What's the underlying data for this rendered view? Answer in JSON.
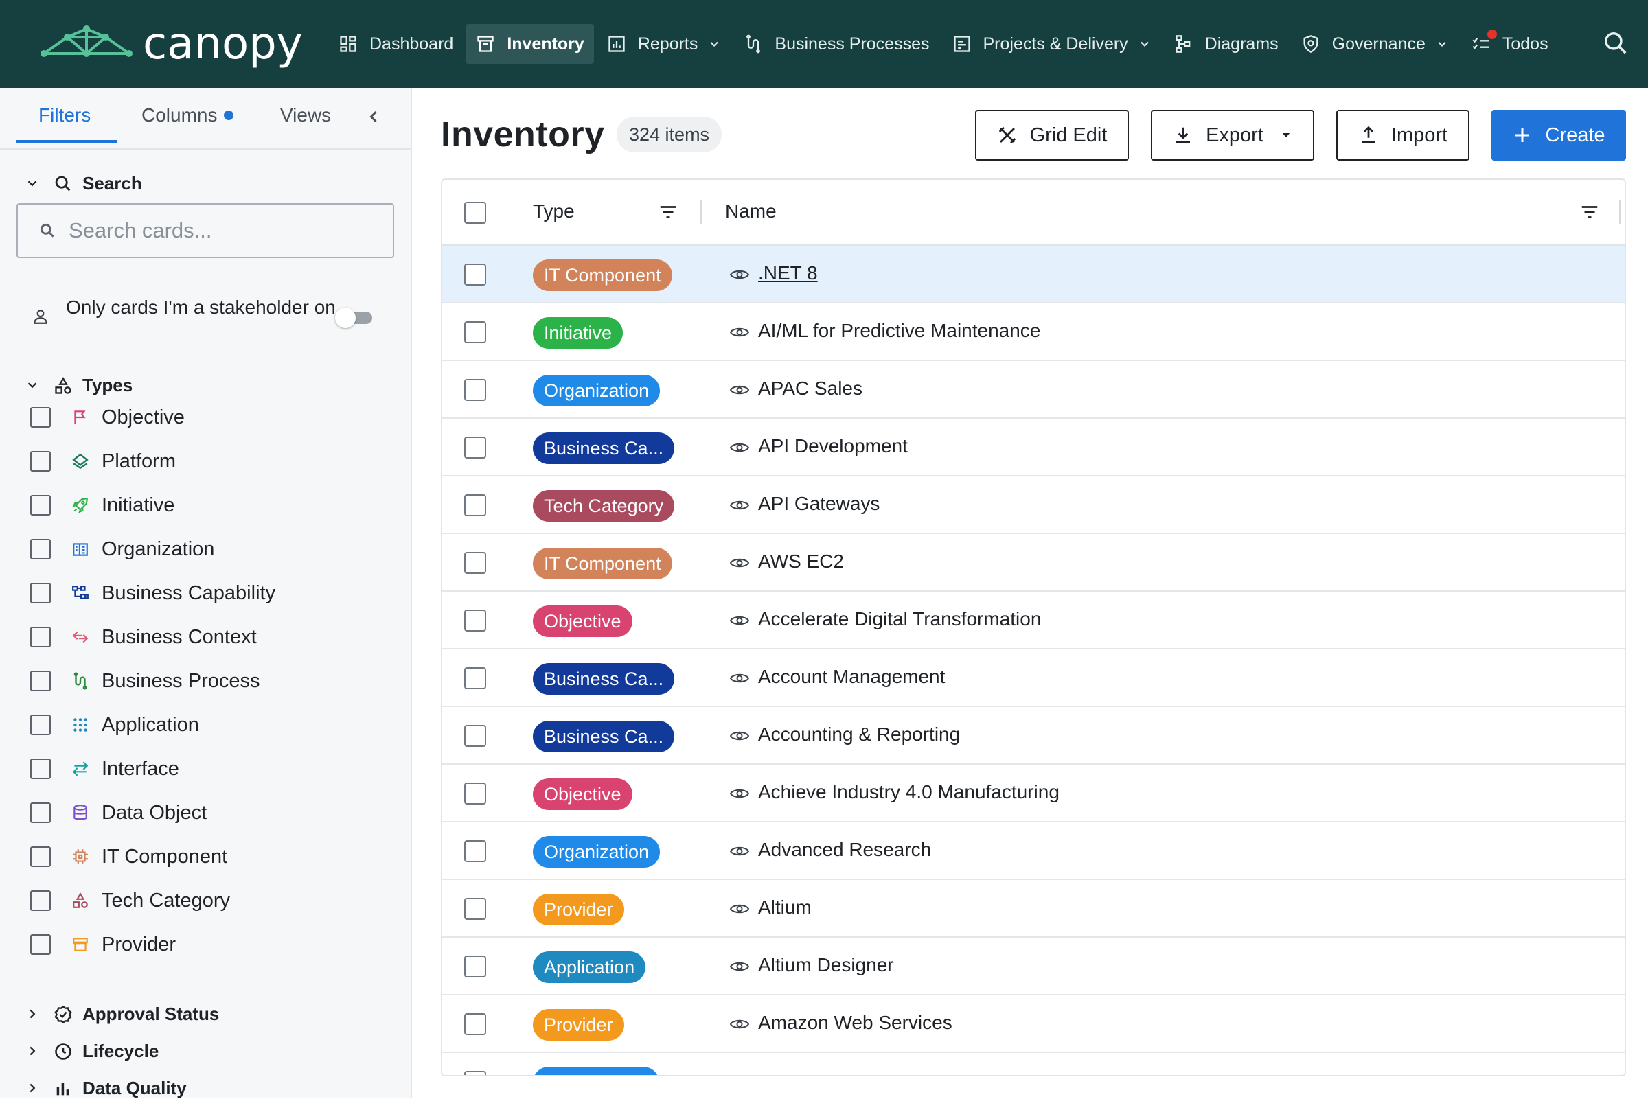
{
  "app": {
    "name": "canopy"
  },
  "nav": [
    {
      "label": "Dashboard",
      "icon": "dashboard-icon",
      "active": false,
      "dropdown": false
    },
    {
      "label": "Inventory",
      "icon": "inventory-icon",
      "active": true,
      "dropdown": false
    },
    {
      "label": "Reports",
      "icon": "reports-icon",
      "active": false,
      "dropdown": true
    },
    {
      "label": "Business Processes",
      "icon": "business-process-icon",
      "active": false,
      "dropdown": false
    },
    {
      "label": "Projects & Delivery",
      "icon": "projects-icon",
      "active": false,
      "dropdown": true
    },
    {
      "label": "Diagrams",
      "icon": "diagrams-icon",
      "active": false,
      "dropdown": false
    },
    {
      "label": "Governance",
      "icon": "governance-icon",
      "active": false,
      "dropdown": true
    },
    {
      "label": "Todos",
      "icon": "todos-icon",
      "active": false,
      "dropdown": false,
      "notification_color": "#e5322d"
    }
  ],
  "sidebar": {
    "tabs": {
      "filters": "Filters",
      "columns": "Columns",
      "views": "Views"
    },
    "search": {
      "heading": "Search",
      "placeholder": "Search cards..."
    },
    "stakeholder": {
      "label": "Only cards I'm a stakeholder on",
      "enabled": false
    },
    "types": {
      "heading": "Types",
      "items": [
        {
          "label": "Objective",
          "icon": "flag-icon",
          "color": "#d8436f"
        },
        {
          "label": "Platform",
          "icon": "layers-icon",
          "color": "#1a7a5a"
        },
        {
          "label": "Initiative",
          "icon": "rocket-icon",
          "color": "#2bb34a"
        },
        {
          "label": "Organization",
          "icon": "building-icon",
          "color": "#1f73d9"
        },
        {
          "label": "Business Capability",
          "icon": "hierarchy-icon",
          "color": "#123a9a"
        },
        {
          "label": "Business Context",
          "icon": "exchange-icon",
          "color": "#e25a7a"
        },
        {
          "label": "Business Process",
          "icon": "process-icon",
          "color": "#2b8a3e"
        },
        {
          "label": "Application",
          "icon": "grid-dots-icon",
          "color": "#1f8ac0"
        },
        {
          "label": "Interface",
          "icon": "arrows-icon",
          "color": "#14a3a3"
        },
        {
          "label": "Data Object",
          "icon": "database-icon",
          "color": "#7b4fc9"
        },
        {
          "label": "IT Component",
          "icon": "chip-icon",
          "color": "#d2835a"
        },
        {
          "label": "Tech Category",
          "icon": "shapes-icon",
          "color": "#a94a5e"
        },
        {
          "label": "Provider",
          "icon": "store-icon",
          "color": "#f39a1e"
        }
      ]
    },
    "sections": [
      {
        "label": "Approval Status",
        "icon": "approval-icon"
      },
      {
        "label": "Lifecycle",
        "icon": "clock-icon"
      },
      {
        "label": "Data Quality",
        "icon": "bar-chart-icon"
      }
    ]
  },
  "main": {
    "title": "Inventory",
    "count": "324 items",
    "buttons": {
      "grid_edit": "Grid Edit",
      "export": "Export",
      "import": "Import",
      "create": "Create"
    },
    "columns": {
      "type": "Type",
      "name": "Name"
    },
    "rows": [
      {
        "type": "IT Component",
        "color": "#d2835a",
        "name": ".NET 8",
        "selected": true,
        "link": true
      },
      {
        "type": "Initiative",
        "color": "#2bb34a",
        "name": "AI/ML for Predictive Maintenance"
      },
      {
        "type": "Organization",
        "color": "#1f8ae8",
        "name": "APAC Sales"
      },
      {
        "type": "Business Ca...",
        "color": "#123a9a",
        "name": "API Development"
      },
      {
        "type": "Tech Category",
        "color": "#a94a5e",
        "name": "API Gateways"
      },
      {
        "type": "IT Component",
        "color": "#d2835a",
        "name": "AWS EC2"
      },
      {
        "type": "Objective",
        "color": "#d8436f",
        "name": "Accelerate Digital Transformation"
      },
      {
        "type": "Business Ca...",
        "color": "#123a9a",
        "name": "Account Management"
      },
      {
        "type": "Business Ca...",
        "color": "#123a9a",
        "name": "Accounting & Reporting"
      },
      {
        "type": "Objective",
        "color": "#d8436f",
        "name": "Achieve Industry 4.0 Manufacturing"
      },
      {
        "type": "Organization",
        "color": "#1f8ae8",
        "name": "Advanced Research"
      },
      {
        "type": "Provider",
        "color": "#f39a1e",
        "name": "Altium"
      },
      {
        "type": "Application",
        "color": "#1f8ac0",
        "name": "Altium Designer"
      },
      {
        "type": "Provider",
        "color": "#f39a1e",
        "name": "Amazon Web Services"
      }
    ]
  }
}
